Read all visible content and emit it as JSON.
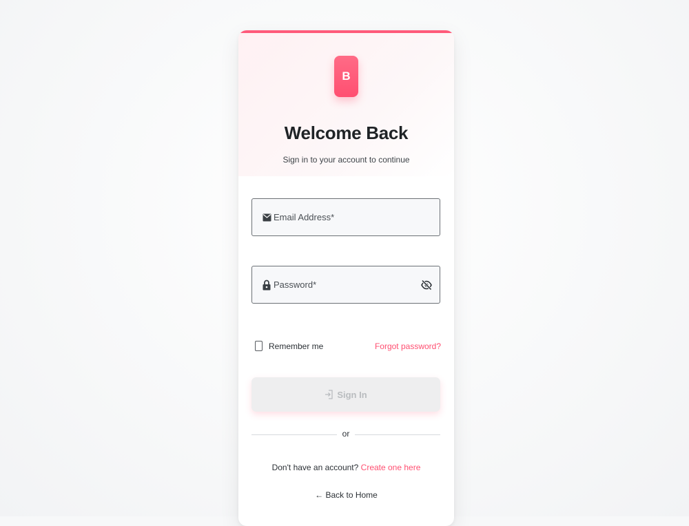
{
  "colors": {
    "accent": "#ff5a7a",
    "link": "#ff4f71",
    "logo_bg": "#ff5a7a",
    "button_disabled_bg": "#eeeeef",
    "button_disabled_text": "#b9bcbf"
  },
  "logo": {
    "letter": "B"
  },
  "header": {
    "title": "Welcome Back",
    "subtitle": "Sign in to your account to continue"
  },
  "form": {
    "email": {
      "placeholder": "Email Address*",
      "value": "",
      "icon": "envelope-icon"
    },
    "password": {
      "placeholder": "Password*",
      "value": "",
      "icon": "lock-icon",
      "toggle_icon": "eye-off-icon"
    },
    "remember_label": "Remember me",
    "remember_checked": false,
    "forgot_label": "Forgot password?",
    "submit_label": "Sign In",
    "submit_icon": "login-icon",
    "submit_disabled": true
  },
  "divider": {
    "label": "or"
  },
  "signup": {
    "prompt": "Don't have an account?",
    "link_label": "Create one here"
  },
  "back": {
    "arrow": "←",
    "label": "Back to Home"
  }
}
